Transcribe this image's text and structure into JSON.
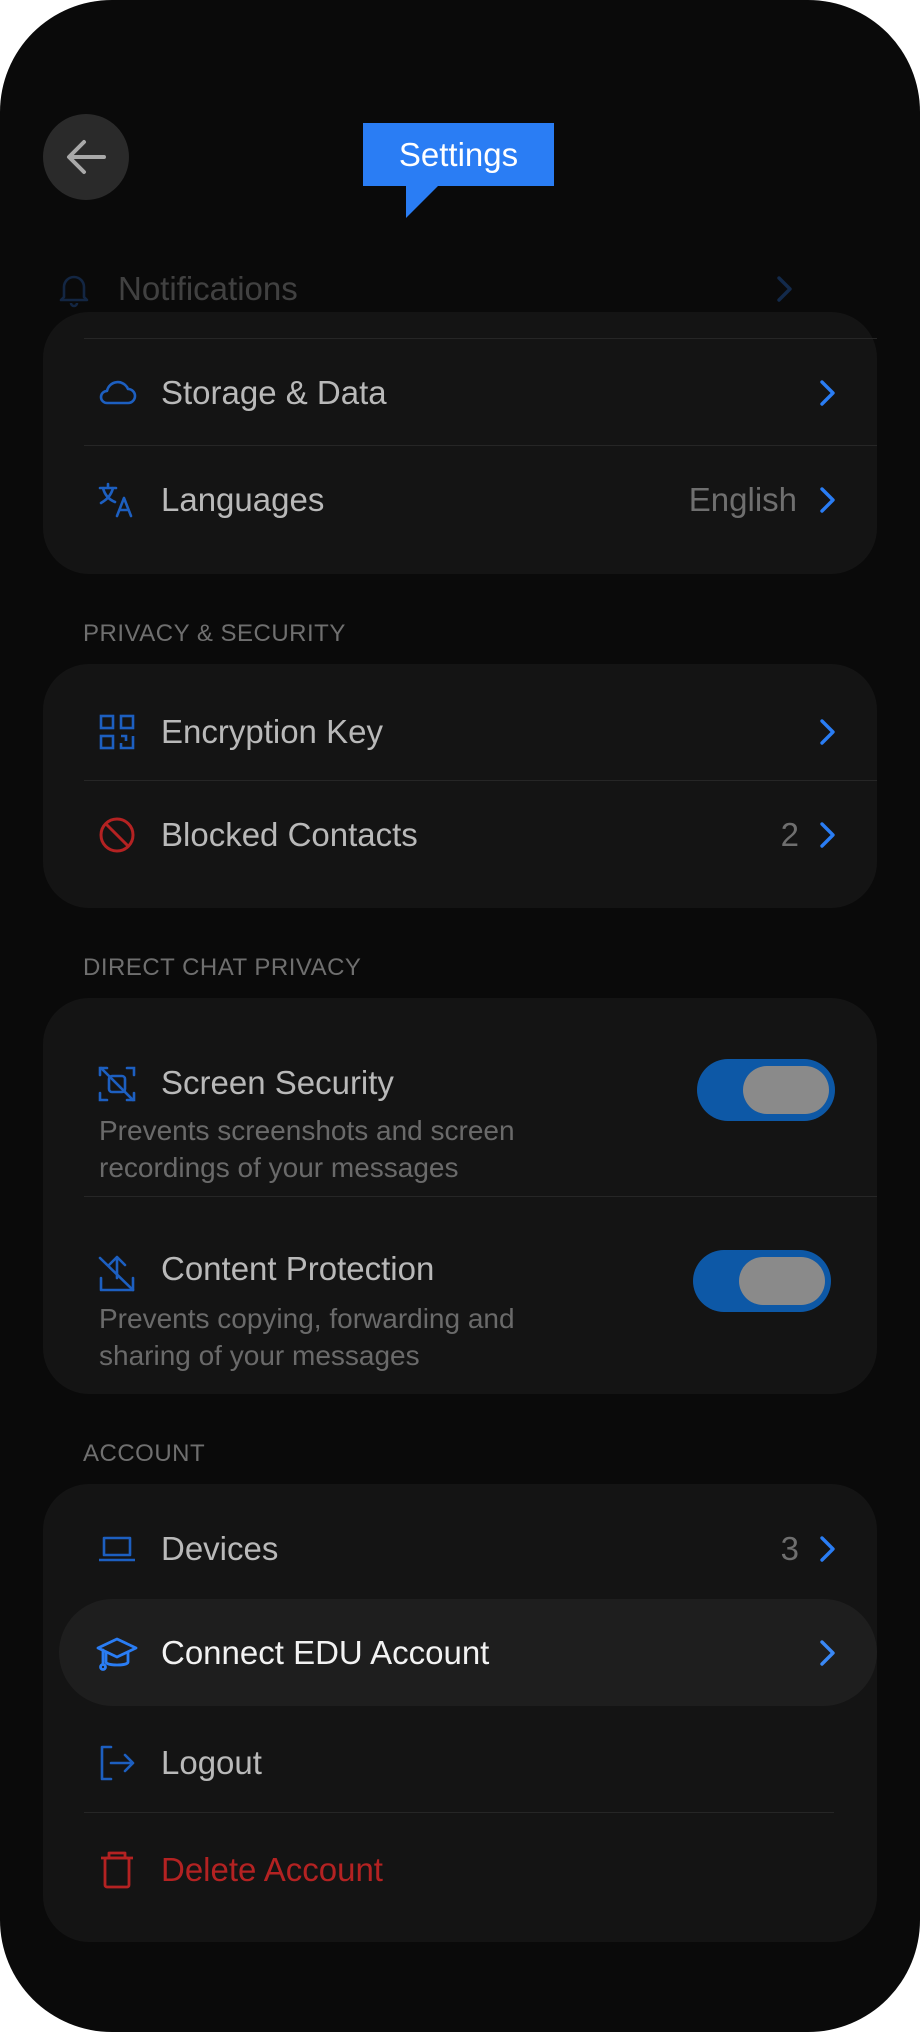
{
  "header": {
    "back_icon": "arrow-left-icon",
    "tooltip_title": "Settings"
  },
  "general": {
    "notifications": {
      "label": "Notifications",
      "icon": "bell-icon"
    },
    "storage": {
      "label": "Storage & Data",
      "icon": "cloud-icon"
    },
    "languages": {
      "label": "Languages",
      "value": "English",
      "icon": "translate-icon"
    }
  },
  "privacy_security": {
    "header": "PRIVACY & SECURITY",
    "encryption": {
      "label": "Encryption Key",
      "icon": "qr-code-icon"
    },
    "blocked": {
      "label": "Blocked Contacts",
      "value": "2",
      "icon": "block-icon"
    }
  },
  "direct_chat_privacy": {
    "header": "DIRECT CHAT PRIVACY",
    "screen_security": {
      "label": "Screen Security",
      "description_line1": "Prevents screenshots and screen",
      "description_line2": "recordings of your messages",
      "enabled": true,
      "icon": "screen-scan-off-icon"
    },
    "content_protection": {
      "label": "Content Protection",
      "description_line1": "Prevents copying, forwarding and",
      "description_line2": "sharing of your messages",
      "enabled": true,
      "icon": "share-off-icon"
    }
  },
  "account": {
    "header": "ACCOUNT",
    "devices": {
      "label": "Devices",
      "value": "3",
      "icon": "laptop-icon"
    },
    "edu": {
      "label": "Connect EDU Account",
      "icon": "graduation-cap-icon"
    },
    "logout": {
      "label": "Logout",
      "icon": "logout-icon"
    },
    "delete": {
      "label": "Delete Account",
      "icon": "trash-icon"
    }
  },
  "colors": {
    "background": "#0a0a0a",
    "card": "#141414",
    "accent_blue": "#2a7df4",
    "icon_blue": "#1d5fc0",
    "danger_red": "#b42222",
    "toggle_track": "#0d58a6"
  }
}
